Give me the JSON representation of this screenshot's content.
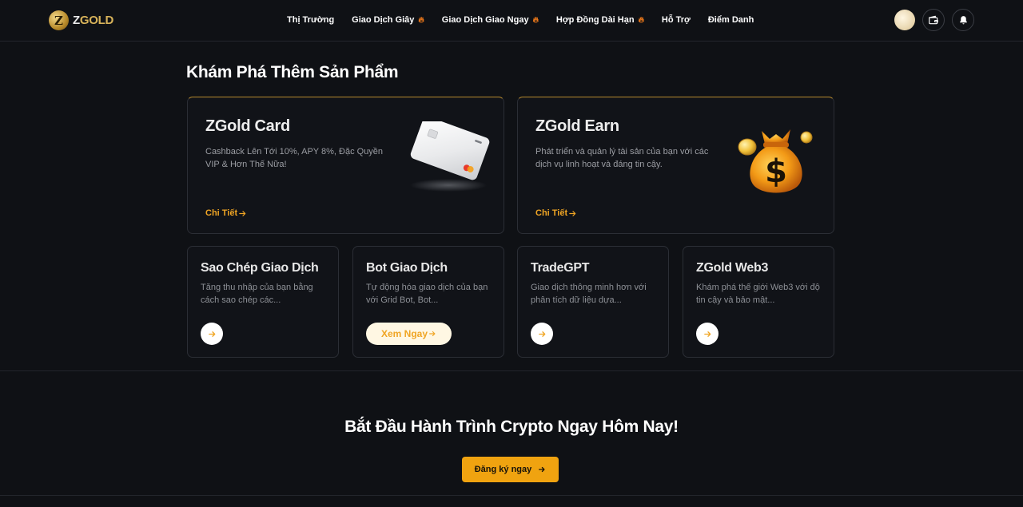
{
  "header": {
    "logo_letter": "Z",
    "logo_brand_a": "Z",
    "logo_brand_b": "GOLD",
    "nav": [
      {
        "label": "Thị Trường",
        "hot": false
      },
      {
        "label": "Giao Dịch Giây",
        "hot": true
      },
      {
        "label": "Giao Dịch Giao Ngay",
        "hot": true
      },
      {
        "label": "Hợp Đồng Dài Hạn",
        "hot": true
      },
      {
        "label": "Hỗ Trợ",
        "hot": false
      },
      {
        "label": "Điểm Danh",
        "hot": false
      }
    ],
    "icons": {
      "wallet": "wallet-icon",
      "bell": "bell-icon",
      "hot": "fire-icon"
    }
  },
  "section": {
    "title": "Khám Phá Thêm Sản Phẩm"
  },
  "big_cards": [
    {
      "title": "ZGold Card",
      "desc": "Cashback Lên Tới 10%, APY 8%, Đặc Quyền VIP & Hơn Thế Nữa!",
      "link": "Chi Tiết",
      "image": "credit-card-image"
    },
    {
      "title": "ZGold Earn",
      "desc": "Phát triển và quản lý tài sản của bạn với các dịch vụ linh hoạt và đáng tin cậy.",
      "link": "Chi Tiết",
      "image": "money-bag-image"
    }
  ],
  "small_cards": [
    {
      "title": "Sao Chép Giao Dịch",
      "desc": "Tăng thu nhập của bạn bằng cách sao chép các..."
    },
    {
      "title": "Bot Giao Dịch",
      "desc": "Tự động hóa giao dịch của bạn với Grid Bot, Bot...",
      "button": "Xem Ngay"
    },
    {
      "title": "TradeGPT",
      "desc": "Giao dịch thông minh hơn với phân tích dữ liệu dựa..."
    },
    {
      "title": "ZGold Web3",
      "desc": "Khám phá thế giới Web3 với độ tin cậy và bảo mật..."
    }
  ],
  "cta": {
    "title": "Bắt Đầu Hành Trình Crypto Ngay Hôm Nay!",
    "button": "Đăng ký ngay"
  },
  "colors": {
    "background": "#0f1115",
    "accent": "#f0a524",
    "cta_button": "#f0a310"
  }
}
